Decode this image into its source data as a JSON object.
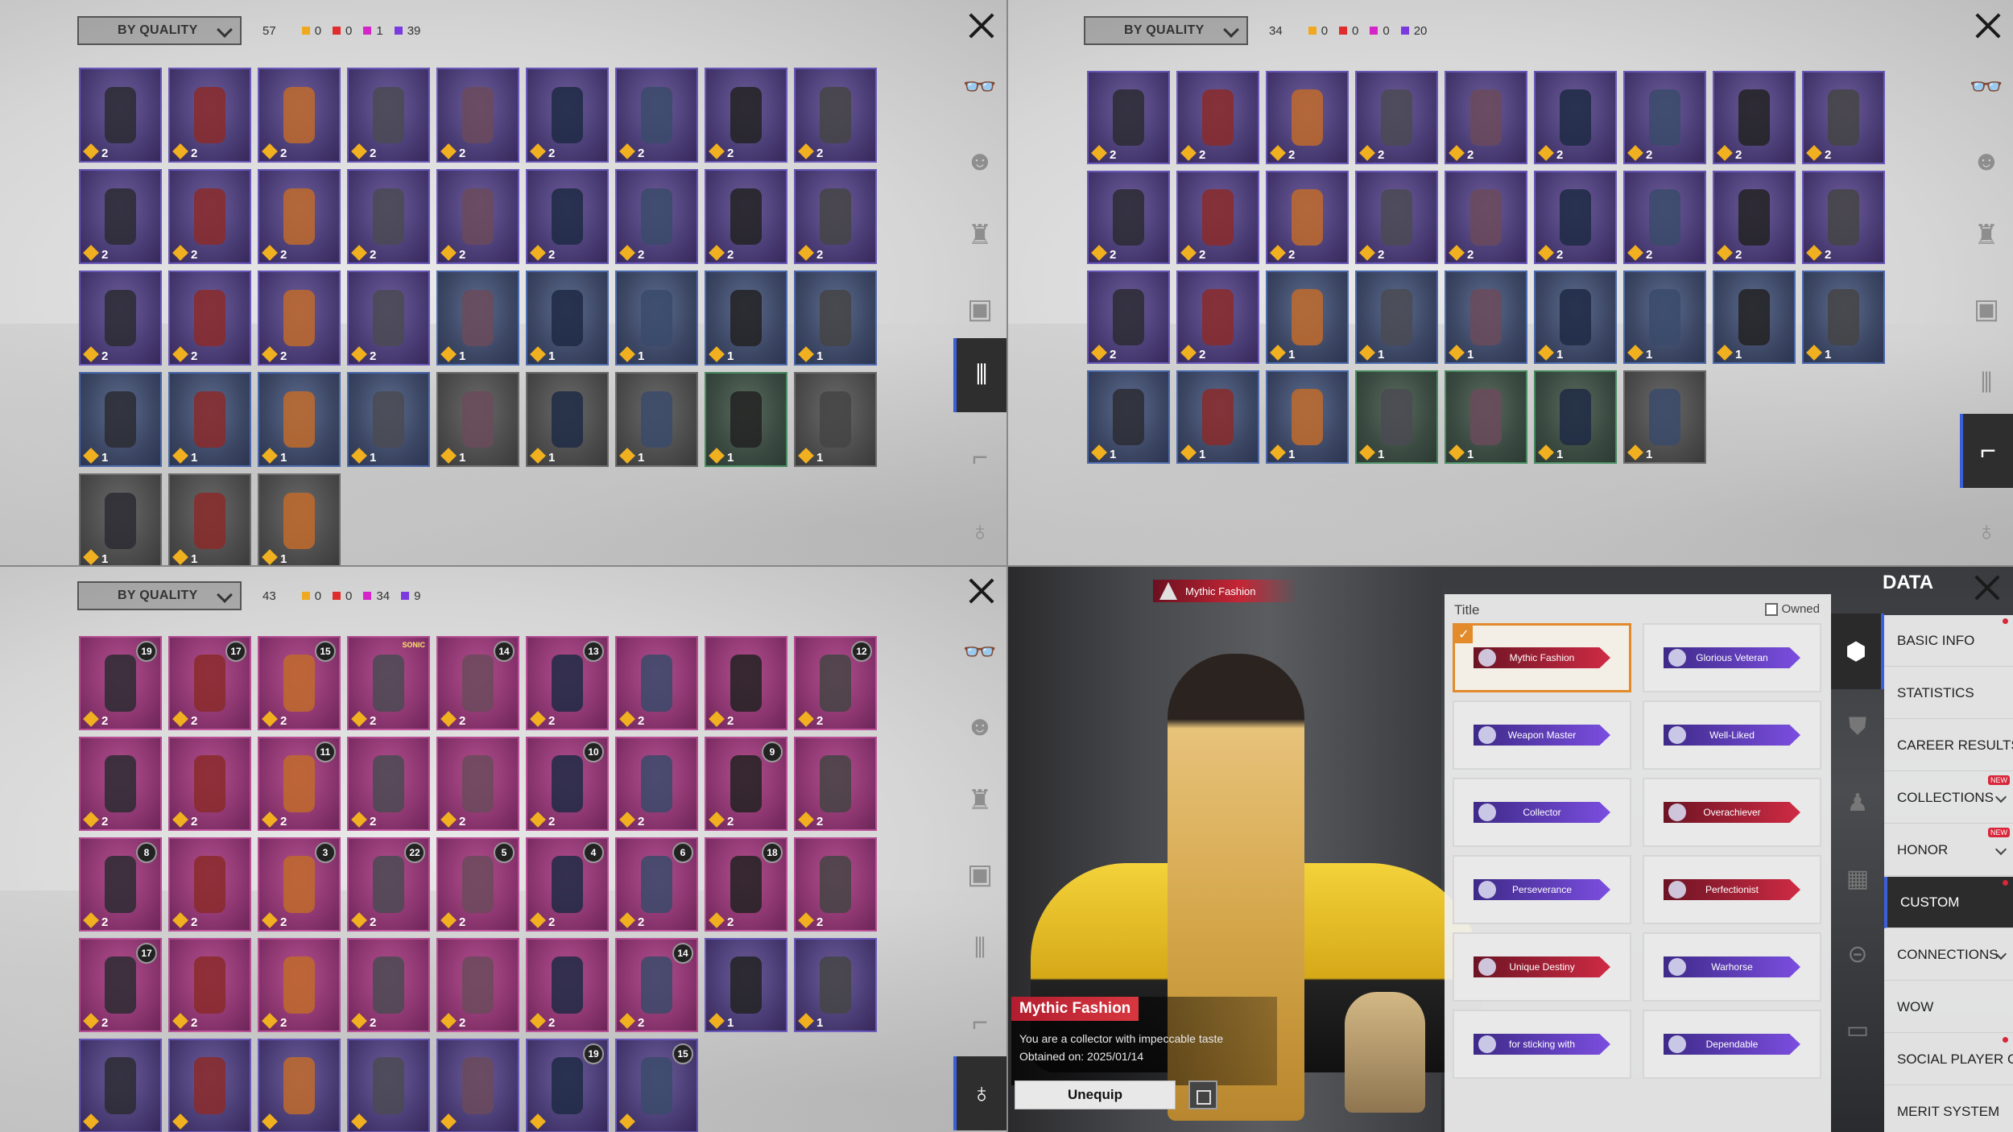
{
  "colors": {
    "gold": "#f0a81e",
    "red": "#e02c2c",
    "magenta": "#d524c8",
    "purple": "#7b3ae0"
  },
  "sort_label": "BY QUALITY",
  "panels": [
    {
      "total": "57",
      "gold": "0",
      "red": "0",
      "magenta": "1",
      "purple": "39",
      "active_tab": "pants-icon",
      "tiles": [
        {
          "q": "purple",
          "c": "2"
        },
        {
          "q": "purple",
          "c": "2"
        },
        {
          "q": "purple",
          "c": "2"
        },
        {
          "q": "purple",
          "c": "2"
        },
        {
          "q": "purple",
          "c": "2"
        },
        {
          "q": "purple",
          "c": "2"
        },
        {
          "q": "purple",
          "c": "2"
        },
        {
          "q": "purple",
          "c": "2"
        },
        {
          "q": "purple",
          "c": "2"
        },
        {
          "q": "purple",
          "c": "2"
        },
        {
          "q": "purple",
          "c": "2"
        },
        {
          "q": "purple",
          "c": "2"
        },
        {
          "q": "purple",
          "c": "2"
        },
        {
          "q": "purple",
          "c": "2"
        },
        {
          "q": "purple",
          "c": "2"
        },
        {
          "q": "purple",
          "c": "2"
        },
        {
          "q": "purple",
          "c": "2"
        },
        {
          "q": "purple",
          "c": "2"
        },
        {
          "q": "purple",
          "c": "2"
        },
        {
          "q": "purple",
          "c": "2"
        },
        {
          "q": "purple",
          "c": "2"
        },
        {
          "q": "purple",
          "c": "2"
        },
        {
          "q": "blue",
          "c": "1"
        },
        {
          "q": "blue",
          "c": "1"
        },
        {
          "q": "blue",
          "c": "1"
        },
        {
          "q": "blue",
          "c": "1"
        },
        {
          "q": "blue",
          "c": "1"
        },
        {
          "q": "blue",
          "c": "1"
        },
        {
          "q": "blue",
          "c": "1"
        },
        {
          "q": "blue",
          "c": "1"
        },
        {
          "q": "blue",
          "c": "1"
        },
        {
          "q": "grey",
          "c": "1"
        },
        {
          "q": "grey",
          "c": "1"
        },
        {
          "q": "grey",
          "c": "1"
        },
        {
          "q": "green",
          "c": "1"
        },
        {
          "q": "grey",
          "c": "1"
        },
        {
          "q": "grey",
          "c": "1"
        },
        {
          "q": "grey",
          "c": "1"
        },
        {
          "q": "grey",
          "c": "1"
        }
      ]
    },
    {
      "total": "34",
      "gold": "0",
      "red": "0",
      "magenta": "0",
      "purple": "20",
      "active_tab": "shoes-icon",
      "tiles": [
        {
          "q": "purple",
          "c": "2"
        },
        {
          "q": "purple",
          "c": "2"
        },
        {
          "q": "purple",
          "c": "2"
        },
        {
          "q": "purple",
          "c": "2"
        },
        {
          "q": "purple",
          "c": "2"
        },
        {
          "q": "purple",
          "c": "2"
        },
        {
          "q": "purple",
          "c": "2"
        },
        {
          "q": "purple",
          "c": "2"
        },
        {
          "q": "purple",
          "c": "2"
        },
        {
          "q": "purple",
          "c": "2"
        },
        {
          "q": "purple",
          "c": "2"
        },
        {
          "q": "purple",
          "c": "2"
        },
        {
          "q": "purple",
          "c": "2"
        },
        {
          "q": "purple",
          "c": "2"
        },
        {
          "q": "purple",
          "c": "2"
        },
        {
          "q": "purple",
          "c": "2"
        },
        {
          "q": "purple",
          "c": "2"
        },
        {
          "q": "purple",
          "c": "2"
        },
        {
          "q": "purple",
          "c": "2"
        },
        {
          "q": "purple",
          "c": "2"
        },
        {
          "q": "blue",
          "c": "1"
        },
        {
          "q": "blue",
          "c": "1"
        },
        {
          "q": "blue",
          "c": "1"
        },
        {
          "q": "blue",
          "c": "1"
        },
        {
          "q": "blue",
          "c": "1"
        },
        {
          "q": "blue",
          "c": "1"
        },
        {
          "q": "blue",
          "c": "1"
        },
        {
          "q": "blue",
          "c": "1"
        },
        {
          "q": "blue",
          "c": "1"
        },
        {
          "q": "blue",
          "c": "1"
        },
        {
          "q": "green",
          "c": "1"
        },
        {
          "q": "green",
          "c": "1"
        },
        {
          "q": "green",
          "c": "1"
        },
        {
          "q": "grey",
          "c": "1"
        }
      ]
    },
    {
      "total": "43",
      "gold": "0",
      "red": "0",
      "magenta": "34",
      "purple": "9",
      "active_tab": "pendant-icon",
      "tiles": [
        {
          "q": "pink",
          "c": "2",
          "lv": "19"
        },
        {
          "q": "pink",
          "c": "2",
          "lv": "17"
        },
        {
          "q": "pink",
          "c": "2",
          "lv": "15"
        },
        {
          "q": "pink",
          "c": "2",
          "logo": "SONIC"
        },
        {
          "q": "pink",
          "c": "2",
          "lv": "14"
        },
        {
          "q": "pink",
          "c": "2",
          "lv": "13"
        },
        {
          "q": "pink",
          "c": "2"
        },
        {
          "q": "pink",
          "c": "2"
        },
        {
          "q": "pink",
          "c": "2",
          "lv": "12"
        },
        {
          "q": "pink",
          "c": "2"
        },
        {
          "q": "pink",
          "c": "2"
        },
        {
          "q": "pink",
          "c": "2",
          "lv": "11"
        },
        {
          "q": "pink",
          "c": "2"
        },
        {
          "q": "pink",
          "c": "2"
        },
        {
          "q": "pink",
          "c": "2",
          "lv": "10"
        },
        {
          "q": "pink",
          "c": "2"
        },
        {
          "q": "pink",
          "c": "2",
          "lv": "9"
        },
        {
          "q": "pink",
          "c": "2"
        },
        {
          "q": "pink",
          "c": "2",
          "lv": "8"
        },
        {
          "q": "pink",
          "c": "2"
        },
        {
          "q": "pink",
          "c": "2",
          "lv": "3"
        },
        {
          "q": "pink",
          "c": "2",
          "lv": "22"
        },
        {
          "q": "pink",
          "c": "2",
          "lv": "5"
        },
        {
          "q": "pink",
          "c": "2",
          "lv": "4"
        },
        {
          "q": "pink",
          "c": "2",
          "lv": "6"
        },
        {
          "q": "pink",
          "c": "2",
          "lv": "18"
        },
        {
          "q": "pink",
          "c": "2"
        },
        {
          "q": "pink",
          "c": "2",
          "lv": "17"
        },
        {
          "q": "pink",
          "c": "2"
        },
        {
          "q": "pink",
          "c": "2"
        },
        {
          "q": "pink",
          "c": "2"
        },
        {
          "q": "pink",
          "c": "2"
        },
        {
          "q": "pink",
          "c": "2"
        },
        {
          "q": "pink",
          "c": "2",
          "lv": "14"
        },
        {
          "q": "purple",
          "c": "1"
        },
        {
          "q": "purple",
          "c": "1"
        },
        {
          "q": "purple",
          "c": ""
        },
        {
          "q": "purple",
          "c": ""
        },
        {
          "q": "purple",
          "c": ""
        },
        {
          "q": "purple",
          "c": ""
        },
        {
          "q": "purple",
          "c": ""
        },
        {
          "q": "purple",
          "c": "",
          "lv": "19"
        },
        {
          "q": "purple",
          "c": "",
          "lv": "15"
        }
      ]
    }
  ],
  "data_panel": {
    "header": "DATA",
    "showcase": {
      "banner": "Mythic Fashion",
      "title": "Mythic Fashion",
      "desc": "You are a collector with impeccable taste",
      "date": "Obtained on: 2025/01/14",
      "unequip": "Unequip"
    },
    "title_section": "Title",
    "owned_label": "Owned",
    "titles": [
      {
        "label": "Mythic Fashion",
        "style": "red",
        "selected": true
      },
      {
        "label": "Glorious Veteran",
        "style": "purple"
      },
      {
        "label": "Weapon Master",
        "style": "purple"
      },
      {
        "label": "Well-Liked",
        "style": "purple"
      },
      {
        "label": "Collector",
        "style": "purple"
      },
      {
        "label": "Overachiever",
        "style": "red"
      },
      {
        "label": "Perseverance",
        "style": "purple"
      },
      {
        "label": "Perfectionist",
        "style": "red"
      },
      {
        "label": "Unique Destiny",
        "style": "red"
      },
      {
        "label": "Warhorse",
        "style": "purple"
      },
      {
        "label": "for sticking with",
        "style": "purple"
      },
      {
        "label": "Dependable",
        "style": "purple"
      }
    ],
    "menu": [
      {
        "label": "BASIC INFO",
        "dot": true
      },
      {
        "label": "STATISTICS"
      },
      {
        "label": "CAREER RESULTS"
      },
      {
        "label": "COLLECTIONS",
        "new": "NEW",
        "chev": true
      },
      {
        "label": "HONOR",
        "new": "NEW",
        "chev": true
      },
      {
        "label": "CUSTOM",
        "active": true,
        "dot": true
      },
      {
        "label": "CONNECTIONS",
        "chev": true
      },
      {
        "label": "WOW"
      },
      {
        "label": "SOCIAL PLAYER CAR",
        "dot": true
      },
      {
        "label": "MERIT SYSTEM"
      }
    ]
  }
}
